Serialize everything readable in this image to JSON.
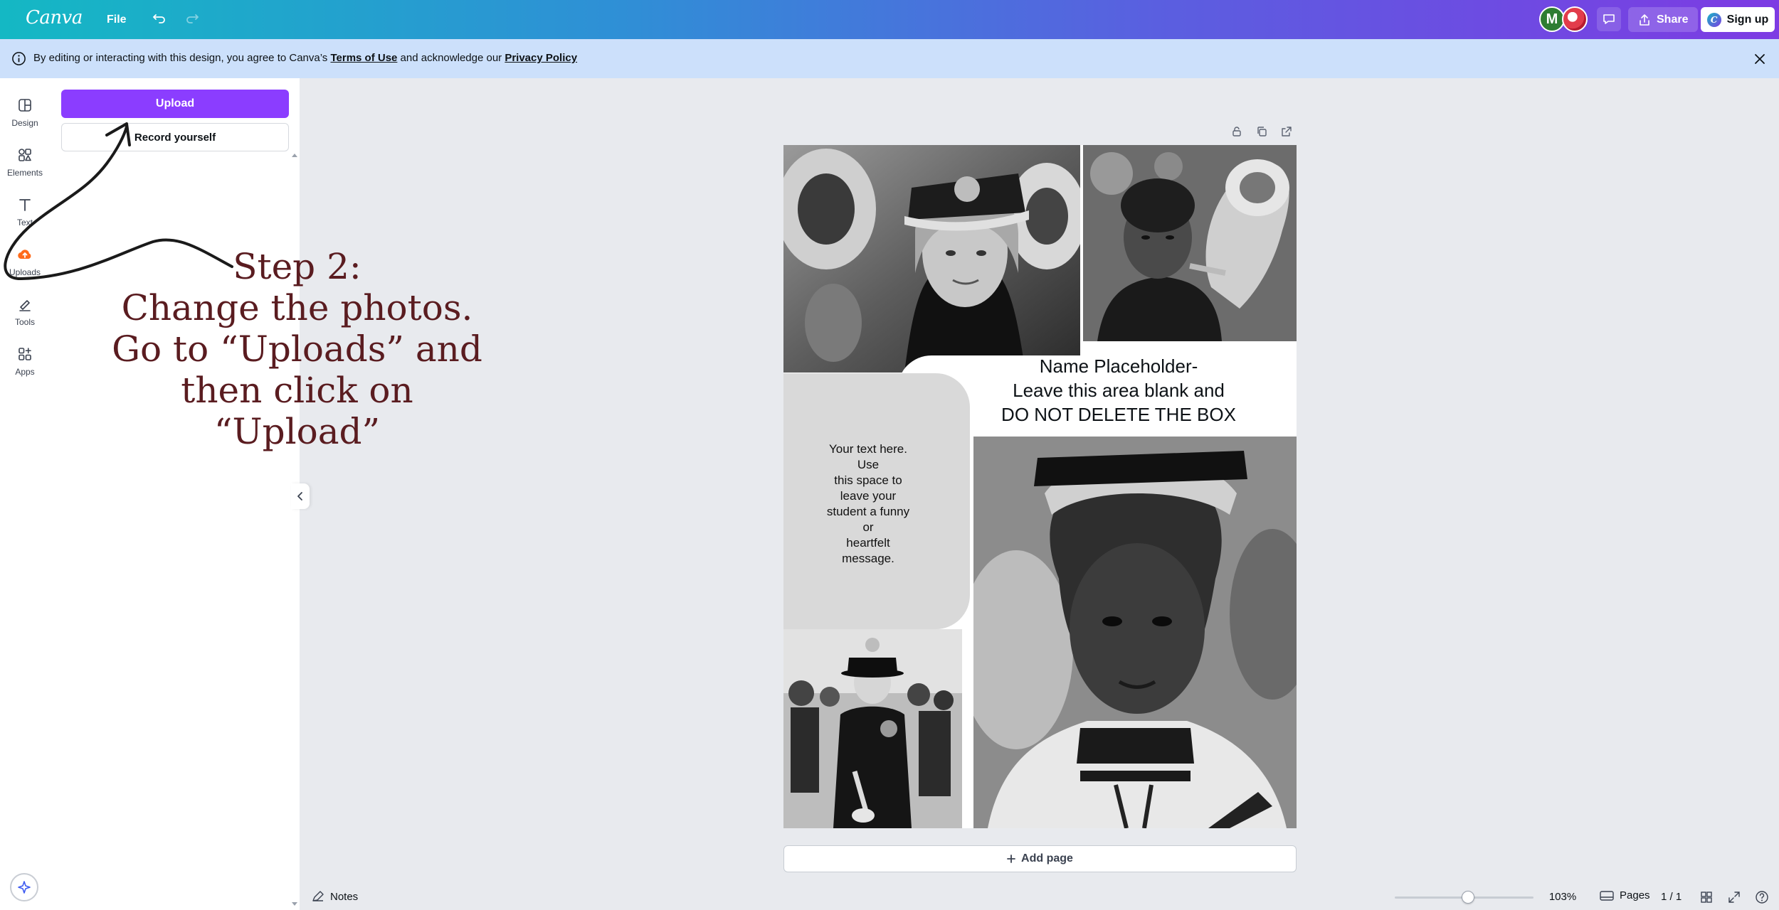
{
  "app": {
    "logo": "Canva",
    "file_label": "File"
  },
  "topbar": {
    "avatar_initial": "M",
    "share_label": "Share",
    "signup_label": "Sign up",
    "signup_logo_letter": "C"
  },
  "notice": {
    "prefix": "By editing or interacting with this design, you agree to Canva’s ",
    "terms": "Terms of Use",
    "middle": " and acknowledge our ",
    "privacy": "Privacy Policy"
  },
  "rail": {
    "design": "Design",
    "elements": "Elements",
    "text": "Text",
    "uploads": "Uploads",
    "tools": "Tools",
    "apps": "Apps"
  },
  "panel": {
    "upload_label": "Upload",
    "record_label": "Record yourself"
  },
  "annotation": {
    "line1": "Step 2:",
    "line2": "Change the photos.",
    "line3": "Go to “Uploads” and",
    "line4": "then click on “Upload”"
  },
  "design": {
    "name_line1": "Name Placeholder-",
    "name_line2": "Leave this area blank and",
    "name_line3": "DO NOT DELETE THE BOX",
    "msg_line1": "Your text here.",
    "msg_line2": "Use",
    "msg_line3": "this space to",
    "msg_line4": "leave your",
    "msg_line5": "student a funny",
    "msg_line6": "or",
    "msg_line7": "heartfelt",
    "msg_line8": "message."
  },
  "canvas": {
    "add_page_label": "Add page"
  },
  "bottombar": {
    "notes_label": "Notes",
    "zoom": "103%",
    "zoom_fraction": 0.53,
    "pages_label": "Pages",
    "page_indicator": "1 / 1"
  },
  "colors": {
    "accent": "#8b3dff",
    "annotation": "#5a1c20",
    "notice_bg": "#cce0fb"
  }
}
